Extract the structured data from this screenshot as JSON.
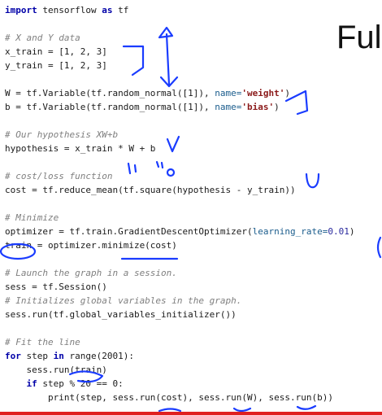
{
  "heading": "Ful",
  "lines": [
    {
      "segs": [
        {
          "t": "import",
          "c": "kw"
        },
        {
          "t": " tensorflow "
        },
        {
          "t": "as",
          "c": "kw"
        },
        {
          "t": " tf"
        }
      ]
    },
    {
      "segs": []
    },
    {
      "segs": [
        {
          "t": "# X and Y data",
          "c": "cm"
        }
      ]
    },
    {
      "segs": [
        {
          "t": "x_train = [1, 2, 3]"
        }
      ]
    },
    {
      "segs": [
        {
          "t": "y_train = [1, 2, 3]"
        }
      ]
    },
    {
      "segs": []
    },
    {
      "segs": [
        {
          "t": "W = tf.Variable(tf.random_normal([1]), "
        },
        {
          "t": "name=",
          "c": "kwarg"
        },
        {
          "t": "'weight'",
          "c": "str"
        },
        {
          "t": ")"
        }
      ]
    },
    {
      "segs": [
        {
          "t": "b = tf.Variable(tf.random_normal([1]), "
        },
        {
          "t": "name=",
          "c": "kwarg"
        },
        {
          "t": "'bias'",
          "c": "str"
        },
        {
          "t": ")"
        }
      ]
    },
    {
      "segs": []
    },
    {
      "segs": [
        {
          "t": "# Our hypothesis XW+b",
          "c": "cm"
        }
      ]
    },
    {
      "segs": [
        {
          "t": "hypothesis = x_train * W + b"
        }
      ]
    },
    {
      "segs": []
    },
    {
      "segs": [
        {
          "t": "# cost/loss function",
          "c": "cm"
        }
      ]
    },
    {
      "segs": [
        {
          "t": "cost = tf.reduce_mean(tf.square(hypothesis - y_train))"
        }
      ]
    },
    {
      "segs": []
    },
    {
      "segs": [
        {
          "t": "# Minimize",
          "c": "cm"
        }
      ]
    },
    {
      "segs": [
        {
          "t": "optimizer = tf.train.GradientDescentOptimizer("
        },
        {
          "t": "learning_rate=",
          "c": "kwarg"
        },
        {
          "t": "0.01",
          "c": "num"
        },
        {
          "t": ")"
        }
      ]
    },
    {
      "segs": [
        {
          "t": "train = optimizer.minimize(cost)"
        }
      ]
    },
    {
      "segs": []
    },
    {
      "segs": [
        {
          "t": "# Launch the graph in a session.",
          "c": "cm"
        }
      ]
    },
    {
      "segs": [
        {
          "t": "sess = tf.Session()"
        }
      ]
    },
    {
      "segs": [
        {
          "t": "# Initializes global variables in the graph.",
          "c": "cm"
        }
      ]
    },
    {
      "segs": [
        {
          "t": "sess.run(tf.global_variables_initializer())"
        }
      ]
    },
    {
      "segs": []
    },
    {
      "segs": [
        {
          "t": "# Fit the line",
          "c": "cm"
        }
      ]
    },
    {
      "segs": [
        {
          "t": "for",
          "c": "kw"
        },
        {
          "t": " step "
        },
        {
          "t": "in",
          "c": "kw"
        },
        {
          "t": " range(2001):"
        }
      ]
    },
    {
      "segs": [
        {
          "t": "    sess.run(train)"
        }
      ]
    },
    {
      "segs": [
        {
          "t": "    "
        },
        {
          "t": "if",
          "c": "kw"
        },
        {
          "t": " step % 20 == 0:"
        }
      ]
    },
    {
      "segs": [
        {
          "t": "        print(step, sess.run(cost), sess.run(W), sess.run(b))"
        }
      ]
    }
  ],
  "annotation_color": "#1a3cff",
  "accent_bar_color": "#e02020"
}
